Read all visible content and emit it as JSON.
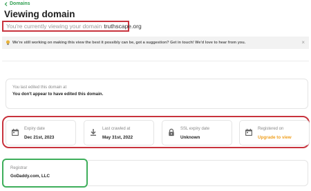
{
  "breadcrumb": {
    "back_label": "Domains"
  },
  "header": {
    "title": "Viewing domain",
    "subtitle_prefix": "You're currently viewing your domain",
    "domain": "truthscape.org"
  },
  "notice": {
    "text": "We're still working on making this view the best it possibly can be, got a suggestion? Get in touch! We'd love to hear from you.",
    "close_glyph": "×"
  },
  "edited": {
    "label": "You last edited this domain at",
    "value": "You don't appear to have edited this domain."
  },
  "stats": [
    {
      "label": "Expiry date",
      "value": "Dec 21st, 2023",
      "icon": "calendar-icon"
    },
    {
      "label": "Last crawled at",
      "value": "May 31st, 2022",
      "icon": "download-icon"
    },
    {
      "label": "SSL expiry date",
      "value": "Unknown",
      "icon": "lock-icon"
    },
    {
      "label": "Registered on",
      "value": "Upgrade to view",
      "icon": "calendar-icon"
    }
  ],
  "registrar": {
    "label": "Registrar",
    "value": "GoDaddy.com, LLC"
  },
  "colors": {
    "accent_green": "#2e9e4f",
    "highlight_red": "#c8323c",
    "upgrade_orange": "#f0a020"
  }
}
